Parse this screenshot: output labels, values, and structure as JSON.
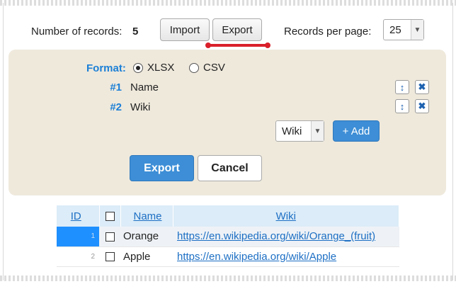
{
  "toolbar": {
    "records_label": "Number of records:",
    "records_count": "5",
    "import_label": "Import",
    "export_label": "Export",
    "rpp_label": "Records per page:",
    "rpp_value": "25"
  },
  "export_panel": {
    "format_label": "Format:",
    "formats": [
      {
        "label": "XLSX",
        "checked": true
      },
      {
        "label": "CSV",
        "checked": false
      }
    ],
    "columns": [
      {
        "num": "#1",
        "name": "Name"
      },
      {
        "num": "#2",
        "name": "Wiki"
      }
    ],
    "column_select_value": "Wiki",
    "add_label": "+ Add",
    "export_label": "Export",
    "cancel_label": "Cancel"
  },
  "table": {
    "headers": {
      "id": "ID",
      "name": "Name",
      "wiki": "Wiki"
    },
    "rows": [
      {
        "id": "1",
        "name": "Orange",
        "wiki": "https://en.wikipedia.org/wiki/Orange_(fruit)"
      },
      {
        "id": "2",
        "name": "Apple",
        "wiki": "https://en.wikipedia.org/wiki/Apple"
      }
    ]
  },
  "colors": {
    "accent": "#3d8ed6",
    "label_blue": "#1d80d6",
    "panel_bg": "#efe9dc",
    "highlight": "#d9202a"
  }
}
